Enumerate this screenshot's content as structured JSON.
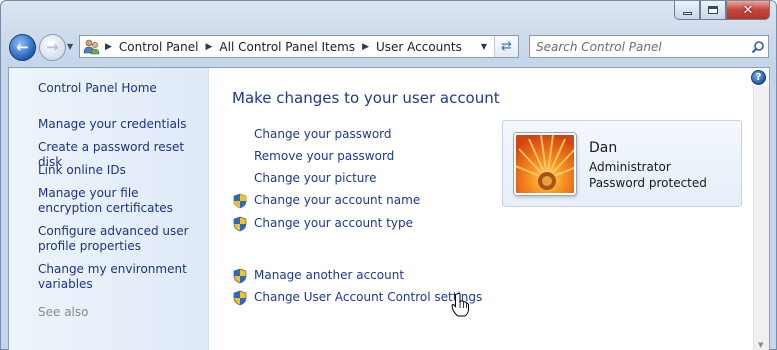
{
  "window": {
    "controls": {
      "minimize": "minimize",
      "maximize": "maximize",
      "close": "close"
    }
  },
  "navigation": {
    "breadcrumbs": [
      "Control Panel",
      "All Control Panel Items",
      "User Accounts"
    ],
    "search_placeholder": "Search Control Panel"
  },
  "sidebar": {
    "home": "Control Panel Home",
    "links": [
      "Manage your credentials",
      "Create a password reset disk",
      "Link online IDs",
      "Manage your file encryption certificates",
      "Configure advanced user profile properties",
      "Change my environment variables"
    ],
    "see_also": "See also"
  },
  "main": {
    "title": "Make changes to your user account",
    "tasks": [
      {
        "label": "Change your password",
        "shield": false
      },
      {
        "label": "Remove your password",
        "shield": false
      },
      {
        "label": "Change your picture",
        "shield": false
      },
      {
        "label": "Change your account name",
        "shield": true
      },
      {
        "label": "Change your account type",
        "shield": true
      }
    ],
    "other_tasks": [
      {
        "label": "Manage another account",
        "shield": true
      },
      {
        "label": "Change User Account Control settings",
        "shield": true
      }
    ]
  },
  "account": {
    "name": "Dan",
    "role": "Administrator",
    "status": "Password protected"
  },
  "colors": {
    "link": "#1c3a8e",
    "title": "#1e3a8a",
    "sidebar_bg": "#e6eff9"
  }
}
